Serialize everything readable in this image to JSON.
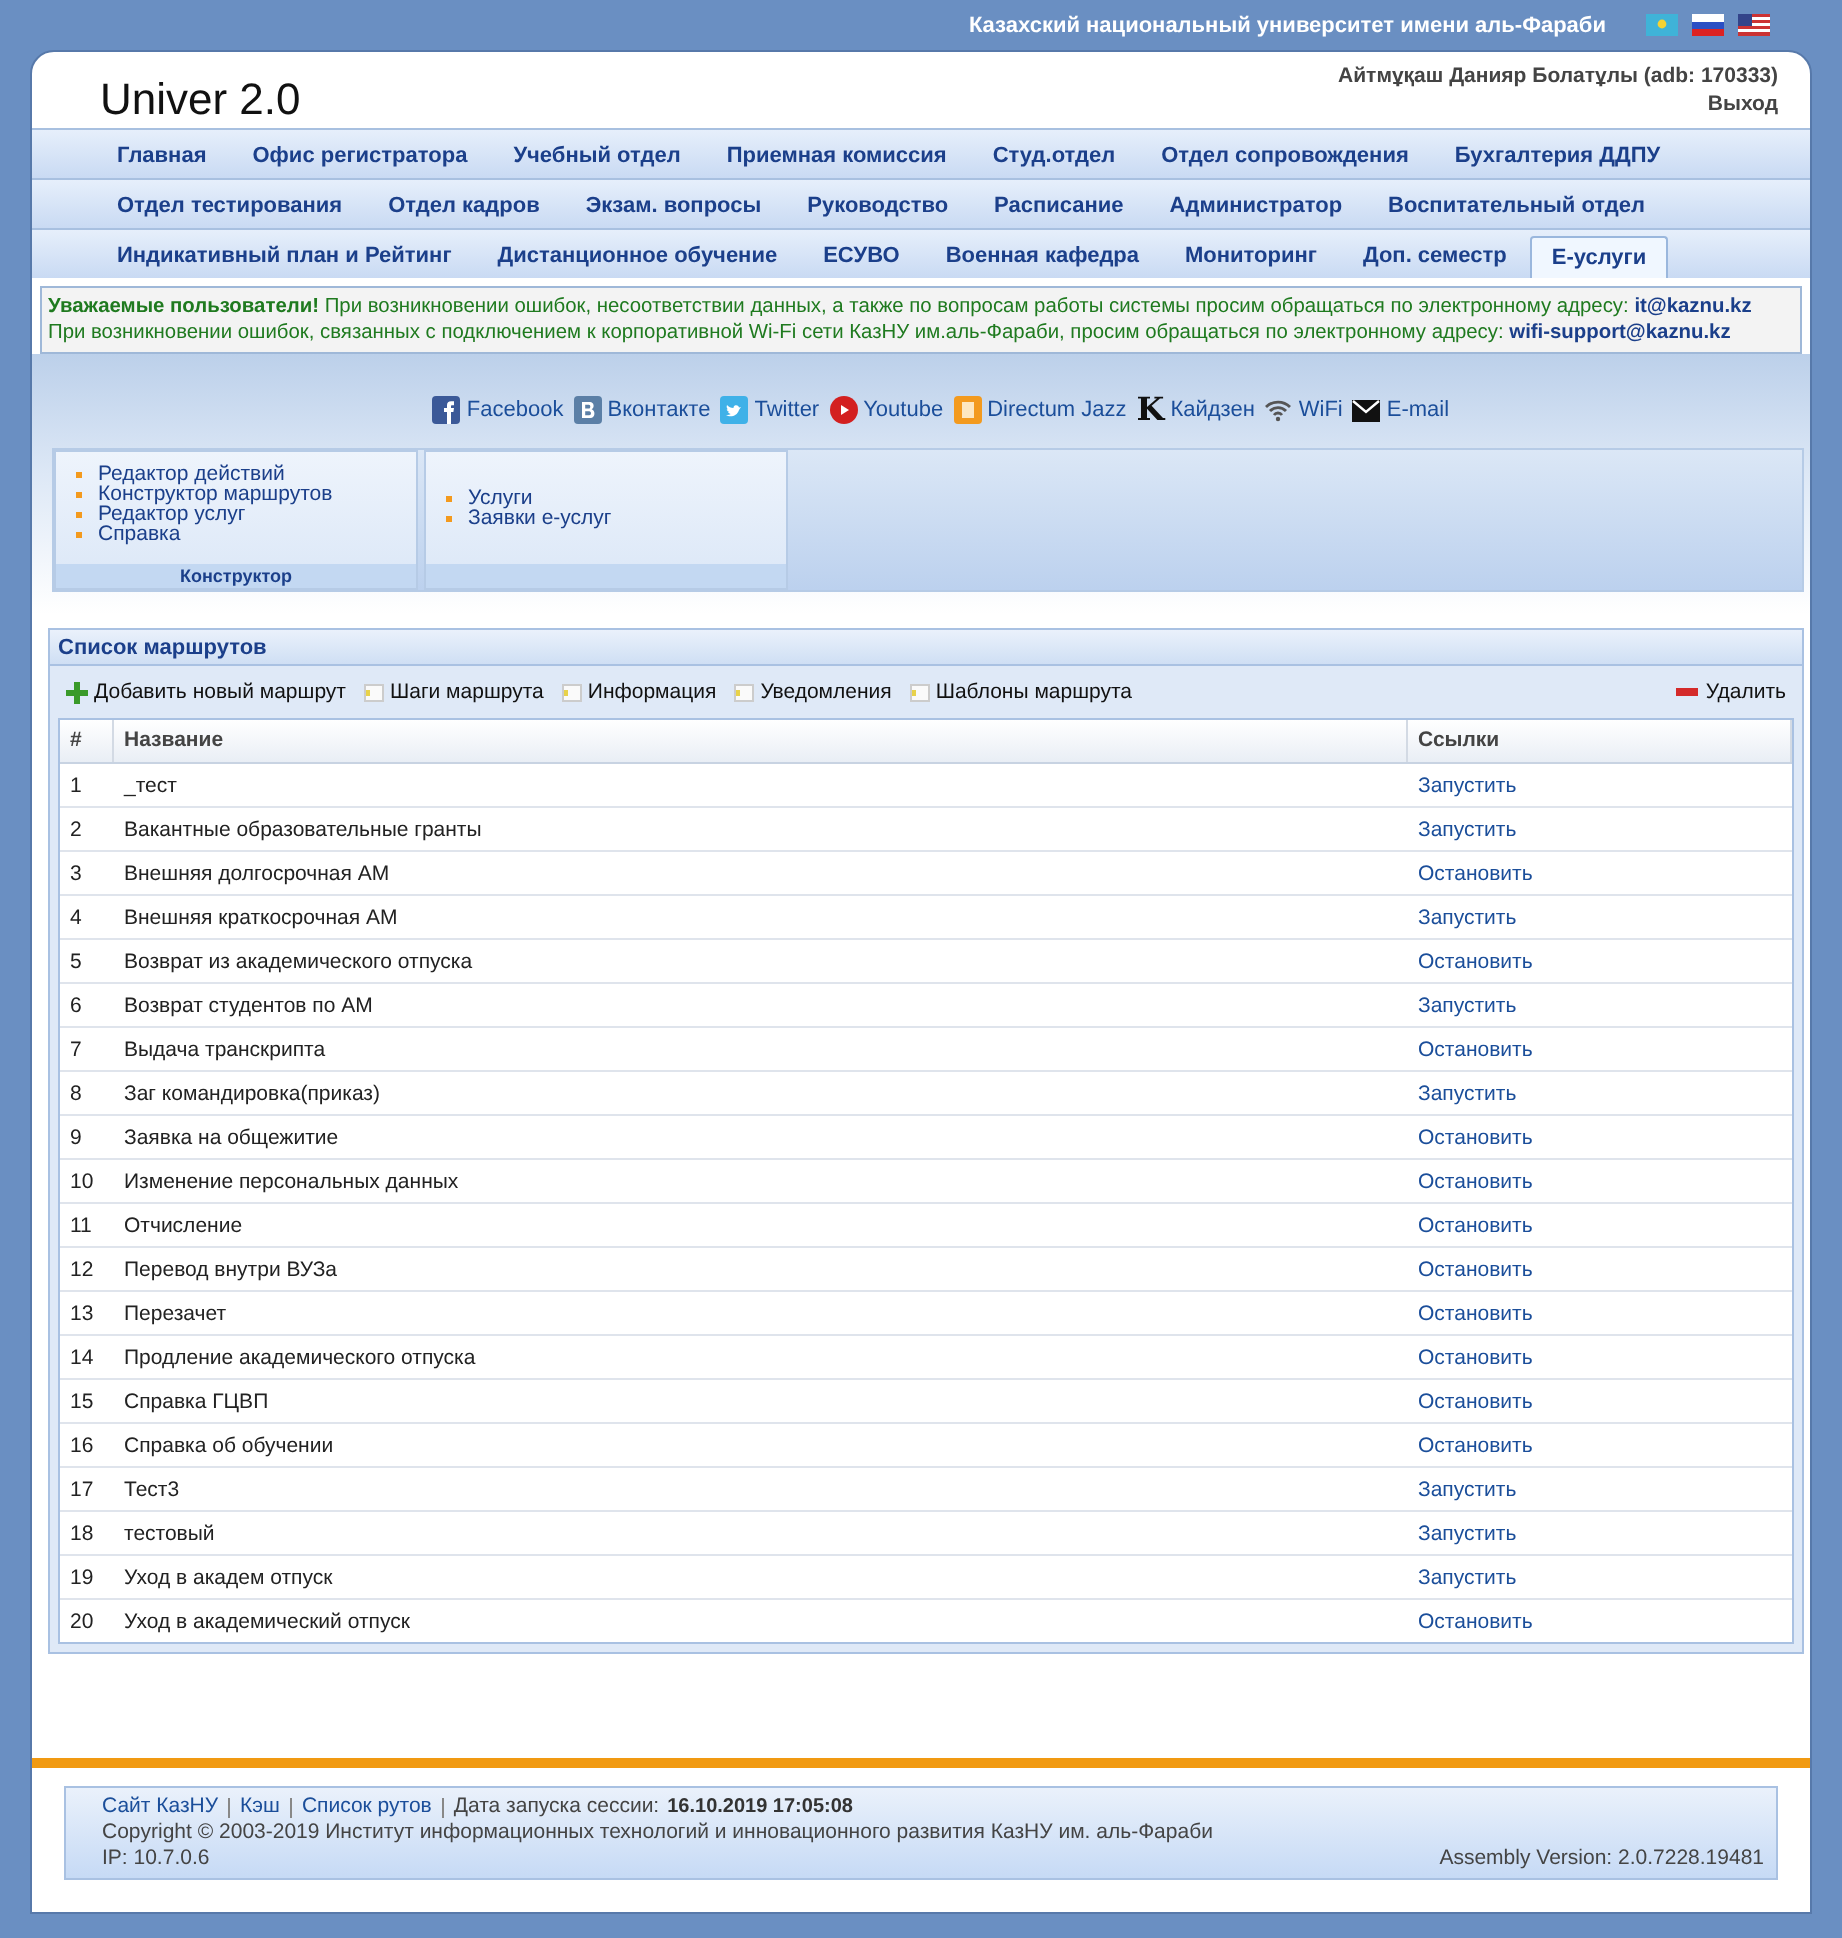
{
  "topbar": {
    "title": "Казахский национальный университет имени аль-Фараби",
    "flags": [
      {
        "kind": "kz"
      },
      {
        "kind": "ru"
      },
      {
        "kind": "us"
      }
    ]
  },
  "header": {
    "logo": "Univer 2.0",
    "user": "Айтмұқаш Данияр Болатұлы (adb: 170333)",
    "logout": "Выход"
  },
  "nav": [
    [
      {
        "label": "Главная",
        "selected": false
      },
      {
        "label": "Офис регистратора",
        "selected": false
      },
      {
        "label": "Учебный отдел",
        "selected": false
      },
      {
        "label": "Приемная комиссия",
        "selected": false
      },
      {
        "label": "Студ.отдел",
        "selected": false
      },
      {
        "label": "Отдел сопровождения",
        "selected": false
      },
      {
        "label": "Бухгалтерия ДДПУ",
        "selected": false
      }
    ],
    [
      {
        "label": "Отдел тестирования",
        "selected": false
      },
      {
        "label": "Отдел кадров",
        "selected": false
      },
      {
        "label": "Экзам. вопросы",
        "selected": false
      },
      {
        "label": "Руководство",
        "selected": false
      },
      {
        "label": "Расписание",
        "selected": false
      },
      {
        "label": "Администратор",
        "selected": false
      },
      {
        "label": "Воспитательный отдел",
        "selected": false
      }
    ],
    [
      {
        "label": "Индикативный план и Рейтинг",
        "selected": false
      },
      {
        "label": "Дистанционное обучение",
        "selected": false
      },
      {
        "label": "ЕСУВО",
        "selected": false
      },
      {
        "label": "Военная кафедра",
        "selected": false
      },
      {
        "label": "Мониторинг",
        "selected": false
      },
      {
        "label": "Доп. семестр",
        "selected": false
      },
      {
        "label": "Е-услуги",
        "selected": true
      }
    ]
  ],
  "notice": [
    "**Уважаемые пользователи!** При возникновении ошибок, несоответствии данных, а также по вопросам работы системы просим обращаться по электронному адресу: **it@kaznu.kz**",
    "При возникновении ошибок, связанных с подключением к корпоративной Wi-Fi сети КазНУ им.аль-Фараби, просим обращаться по электронному адресу: **wifi-support@kaznu.kz**"
  ],
  "social": [
    {
      "kind": "facebook",
      "label": "Facebook"
    },
    {
      "kind": "vk",
      "label": "Вконтакте"
    },
    {
      "kind": "twitter",
      "label": "Twitter"
    },
    {
      "kind": "youtube",
      "label": "Youtube"
    },
    {
      "kind": "jazz",
      "label": "Directum Jazz"
    },
    {
      "kind": "letter",
      "glyph": "K",
      "label": "Кайдзен"
    },
    {
      "kind": "wifi",
      "label": "WiFi"
    },
    {
      "kind": "mail",
      "label": "E-mail"
    }
  ],
  "modules": [
    {
      "items": [
        "Редактор действий",
        "Конструктор маршрутов",
        "Редактор услуг",
        "Справка"
      ],
      "caption": "Конструктор"
    },
    {
      "items": [
        "Услуги",
        "Заявки е-услуг"
      ]
    }
  ],
  "routes": {
    "title": "Список маршрутов",
    "toolbar": [
      {
        "kind": "add",
        "label": "Добавить новый маршрут"
      },
      {
        "kind": "page",
        "label": "Шаги маршрута"
      },
      {
        "kind": "page",
        "label": "Информация"
      },
      {
        "kind": "page",
        "label": "Уведомления"
      },
      {
        "kind": "page",
        "label": "Шаблоны маршрута"
      }
    ],
    "delete": "Удалить",
    "columns": [
      "#",
      "Название",
      "Ссылки"
    ],
    "rows": [
      [
        "1",
        "_тест",
        "Запустить"
      ],
      [
        "2",
        "Вакантные образовательные гранты",
        "Запустить"
      ],
      [
        "3",
        "Внешняя долгосрочная АМ",
        "Остановить"
      ],
      [
        "4",
        "Внешняя краткосрочная АМ",
        "Запустить"
      ],
      [
        "5",
        "Возврат из академического отпуска",
        "Остановить"
      ],
      [
        "6",
        "Возврат студентов по АМ",
        "Запустить"
      ],
      [
        "7",
        "Выдача транскрипта",
        "Остановить"
      ],
      [
        "8",
        "Заг командировка(приказ)",
        "Запустить"
      ],
      [
        "9",
        "Заявка на общежитие",
        "Остановить"
      ],
      [
        "10",
        "Изменение персональных данных",
        "Остановить"
      ],
      [
        "11",
        "Отчисление",
        "Остановить"
      ],
      [
        "12",
        "Перевод внутри ВУЗа",
        "Остановить"
      ],
      [
        "13",
        "Перезачет",
        "Остановить"
      ],
      [
        "14",
        "Продление академического отпуска",
        "Остановить"
      ],
      [
        "15",
        "Справка ГЦВП",
        "Остановить"
      ],
      [
        "16",
        "Справка об обучении",
        "Остановить"
      ],
      [
        "17",
        "Тест3",
        "Запустить"
      ],
      [
        "18",
        "тестовый",
        "Запустить"
      ],
      [
        "19",
        "Уход в академ отпуск",
        "Запустить"
      ],
      [
        "20",
        "Уход в академический отпуск",
        "Остановить"
      ]
    ]
  },
  "footer": {
    "links": [
      "Сайт КазНУ",
      "Кэш",
      "Список рутов"
    ],
    "session_label": "Дата запуска сессии:",
    "session_date": "16.10.2019 17:05:08",
    "copyright": "Copyright © 2003-2019 Институт информационных технологий и инновационного развития КазНУ им. аль-Фараби",
    "ip": "IP: 10.7.0.6",
    "version": "Assembly Version: 2.0.7228.19481"
  }
}
